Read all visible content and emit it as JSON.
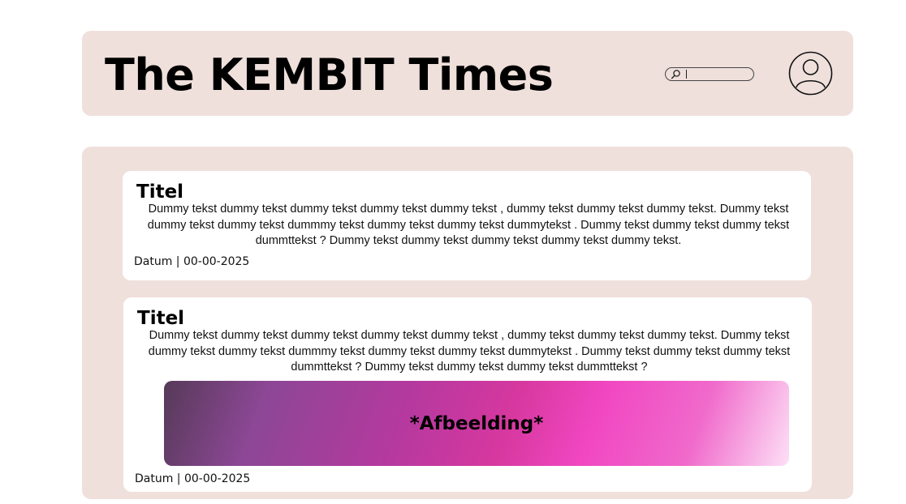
{
  "header": {
    "title": "The KEMBIT Times",
    "search": {
      "placeholder": "",
      "value": "",
      "icon": "search-icon"
    },
    "account_icon": "user-avatar-icon",
    "background_color": "#efe0dc"
  },
  "articles": [
    {
      "title": "Titel",
      "body": "Dummy tekst dummy tekst dummy tekst dummy tekst dummy tekst , dummy tekst dummy tekst dummy tekst. Dummy tekst dummy tekst dummy tekst dummmy tekst dummy tekst dummy tekst dummytekst . Dummy tekst dummy tekst dummy tekst dummttekst ? Dummy tekst dummy tekst dummy tekst dummy tekst dummy tekst.",
      "date": "Datum | 00-00-2025"
    },
    {
      "title": "Titel",
      "body": "Dummy tekst dummy tekst dummy tekst dummy tekst dummy tekst , dummy tekst dummy tekst dummy tekst. Dummy tekst dummy tekst dummy tekst dummmy tekst dummy tekst dummy tekst dummytekst . Dummy tekst dummy tekst dummy tekst dummttekst ? Dummy tekst dummy tekst dummy tekst dummttekst ?",
      "image_label": "*Afbeelding*",
      "date": "Datum | 00-00-2025"
    }
  ],
  "colors": {
    "panel": "#efe0dc",
    "card": "#ffffff",
    "image_gradient": [
      "#563a58",
      "#8c4795",
      "#d7389f",
      "#f147c2",
      "#fde0f6"
    ]
  }
}
